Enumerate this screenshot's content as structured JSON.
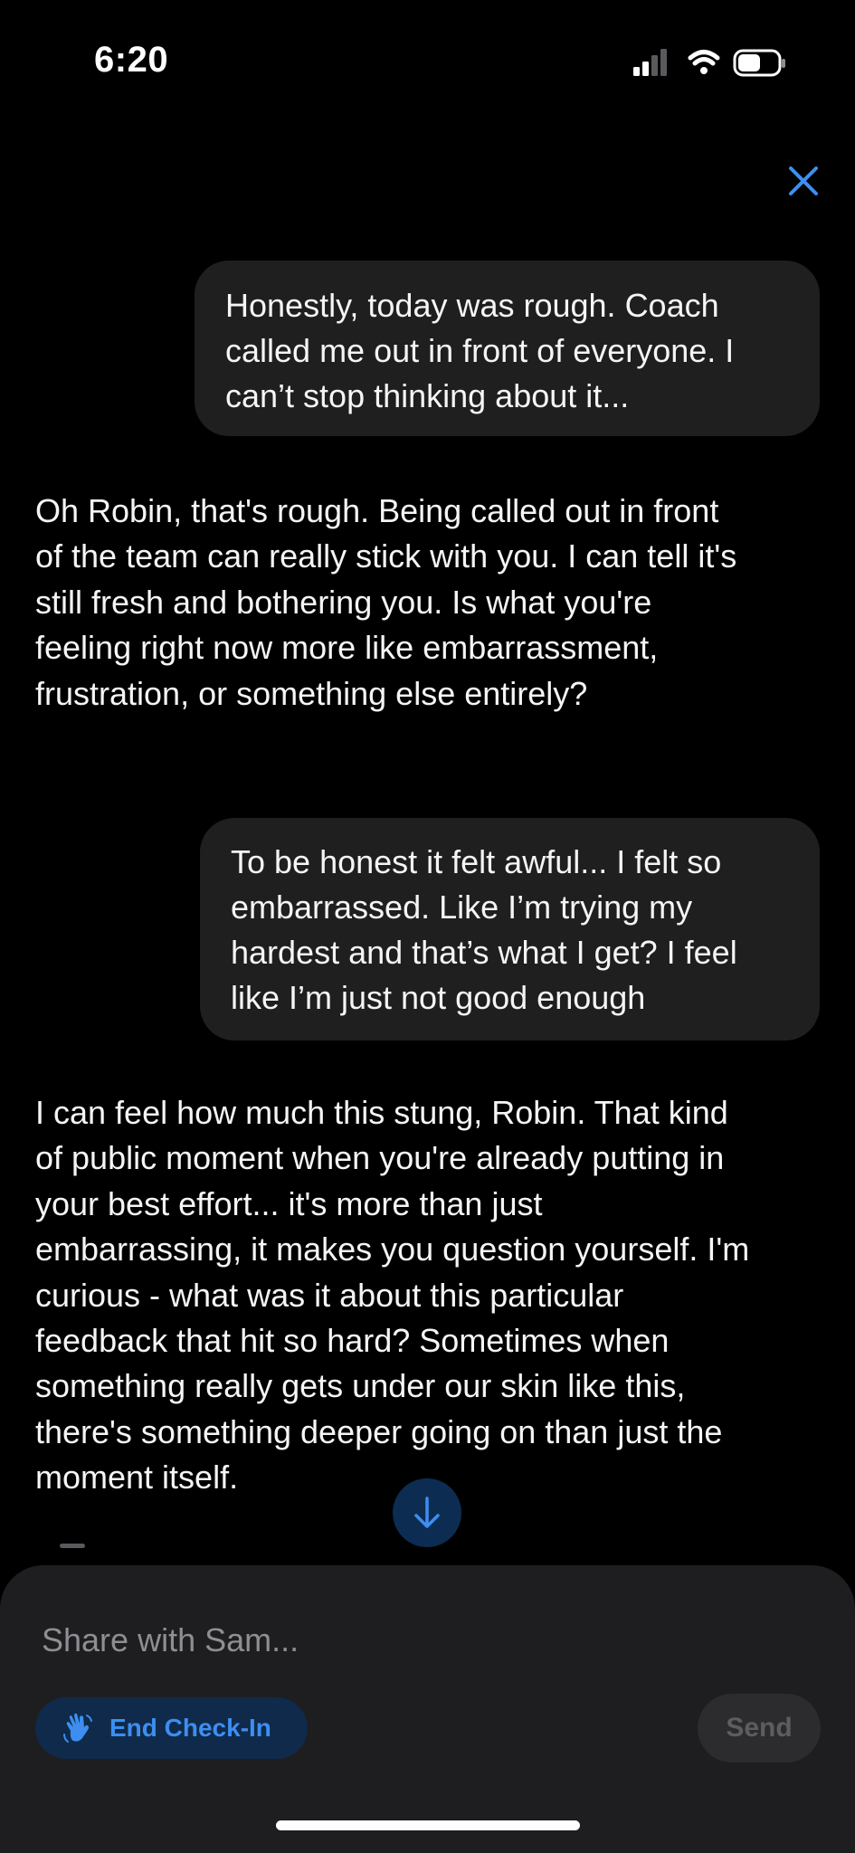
{
  "status_bar": {
    "time": "6:20",
    "icons": [
      "cellular-signal-icon",
      "wifi-icon",
      "battery-icon"
    ]
  },
  "header": {
    "close_icon": "close-icon"
  },
  "messages": [
    {
      "sender": "user",
      "text": "Honestly, today was rough. Coach\ncalled me out in front of everyone. I\ncan’t stop thinking about it..."
    },
    {
      "sender": "assistant",
      "text": "Oh Robin, that's rough. Being called out in front\nof the team can really stick with you. I can tell it's\nstill fresh and bothering you. Is what you're\nfeeling right now more like embarrassment,\nfrustration, or something else entirely?"
    },
    {
      "sender": "user",
      "text": "To be honest it felt awful... I felt so\nembarrassed. Like I’m trying my\nhardest and that’s what I get? I feel\nlike I’m just not good enough"
    },
    {
      "sender": "assistant",
      "text": "I can feel how much this stung, Robin. That kind\nof public moment when you're already putting in\nyour best effort... it's more than just\nembarrassing, it makes you question yourself. I'm\ncurious - what was it about this particular\nfeedback that hit so hard? Sometimes when\nsomething really gets under our skin like this,\nthere's something deeper going on than just the\nmoment itself."
    }
  ],
  "scroll_down_icon": "arrow-down-icon",
  "composer": {
    "placeholder": "Share with Sam...",
    "value": "",
    "end_checkin_label": "End Check-In",
    "end_checkin_icon": "waving-hand-icon",
    "send_label": "Send"
  },
  "colors": {
    "background": "#000000",
    "bubble": "#1f1f20",
    "accent": "#3d8ef0",
    "composer": "#1e1e20"
  }
}
